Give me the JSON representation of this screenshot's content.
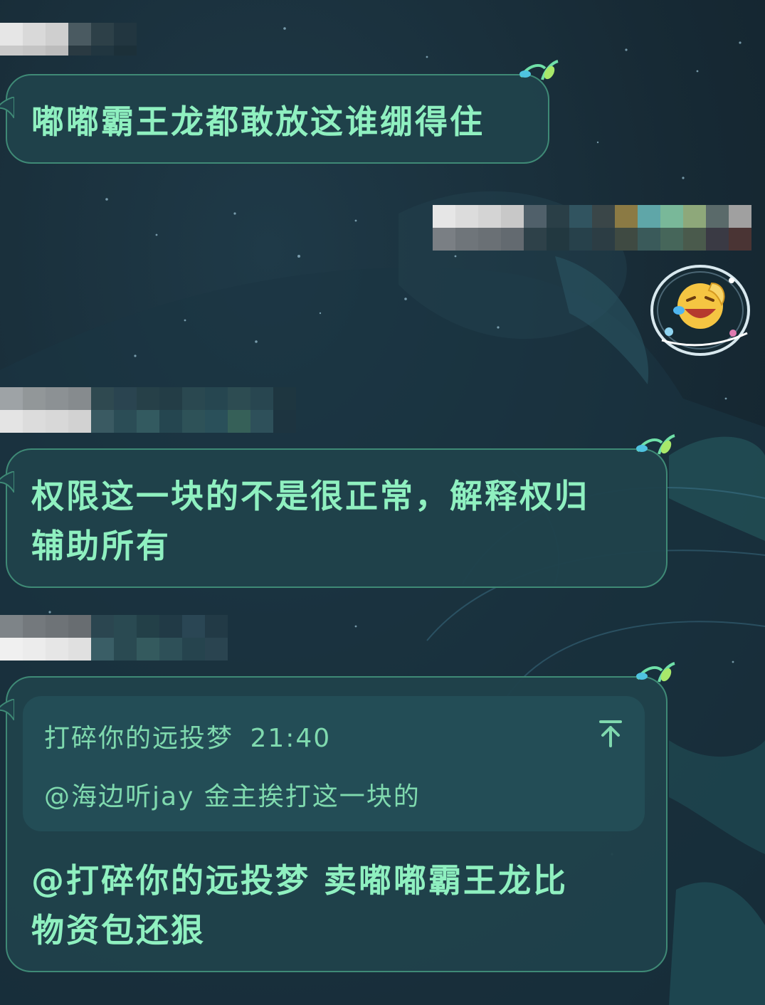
{
  "theme": {
    "background": "#182c37",
    "bubble_fill": "#1f424b",
    "bubble_border": "#3f8a76",
    "message_text": "#8ff0c0",
    "quote_text": "#7fd9ae"
  },
  "messages": [
    {
      "side": "incoming",
      "sender": "[pixelated]",
      "text": "嘟嘟霸王龙都敢放这谁绷得住"
    },
    {
      "side": "outgoing",
      "sender": "[pixelated]",
      "type": "sticker",
      "sticker_icon": "laughing-crying-emoji-icon"
    },
    {
      "side": "incoming",
      "sender": "[pixelated]",
      "text_line1": "权限这一块的不是很正常，解释权归",
      "text_line2": "辅助所有"
    },
    {
      "side": "incoming",
      "sender": "[pixelated]",
      "quote": {
        "author": "打碎你的远投梦",
        "time": "21:40",
        "text": "@海边听jay 金主挨打这一块的",
        "jump_icon": "scroll-to-original-icon"
      },
      "text_line1": "@打碎你的远投梦 卖嘟嘟霸王龙比",
      "text_line2": "物资包还狠"
    }
  ]
}
